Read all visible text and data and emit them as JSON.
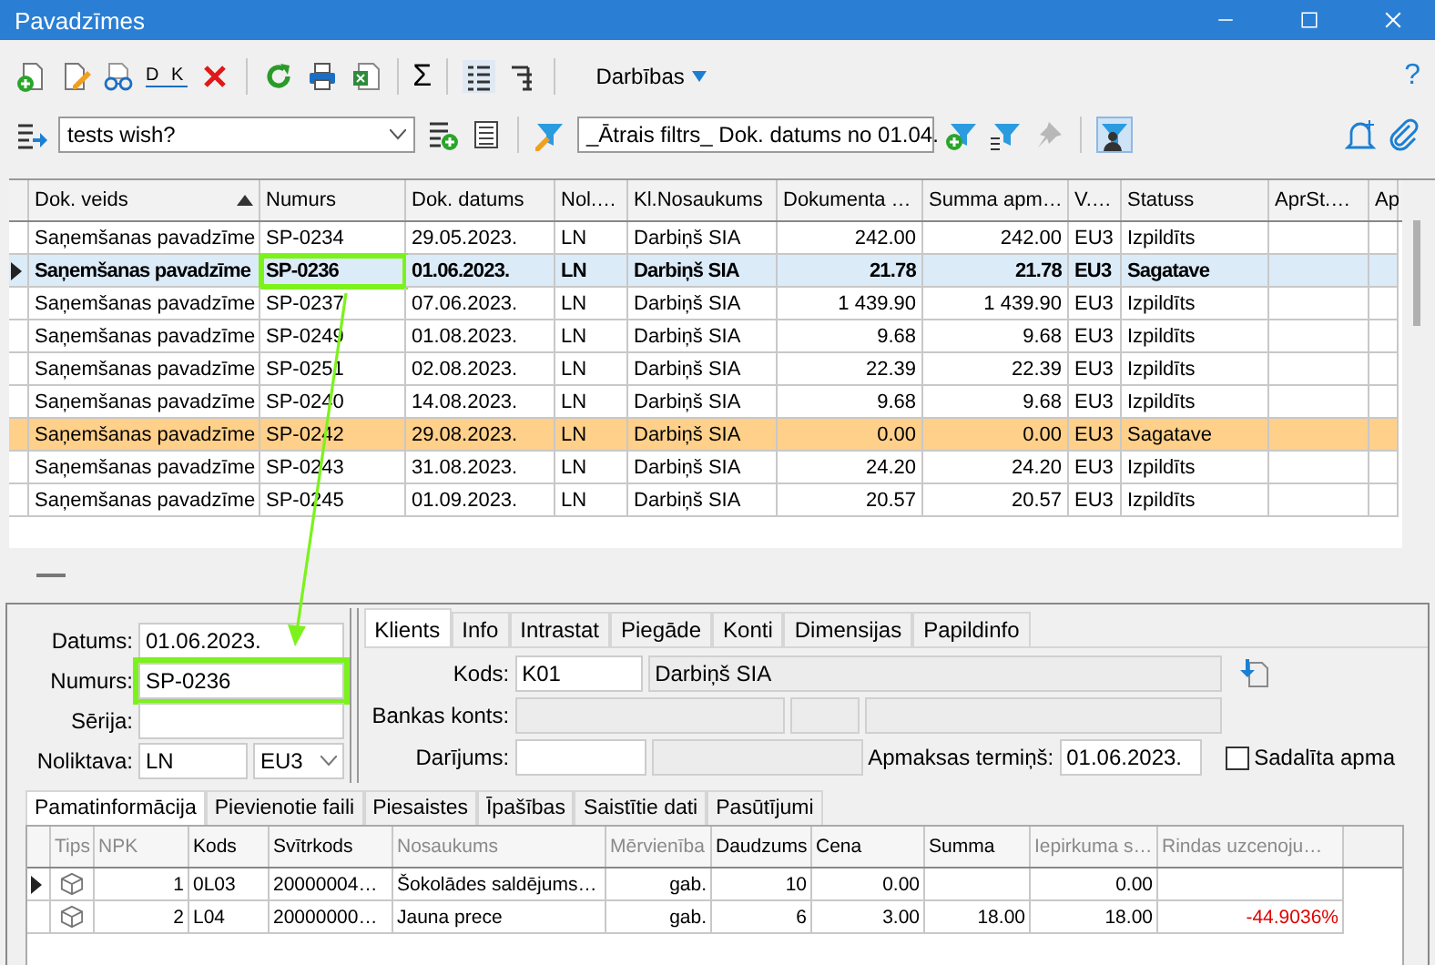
{
  "window": {
    "title": "Pavadzīmes"
  },
  "toolbar": {
    "dk_label": "D K",
    "sum_symbol": "Σ",
    "actions_label": "Darbības",
    "help": "?"
  },
  "filter_bar": {
    "view": "tests wish?",
    "quick_filter": "_Ātrais filtrs_ Dok. datums no 01.04.",
    "user_filter_on": true
  },
  "documents": {
    "columns": [
      {
        "label": "Dok. veids",
        "sorted": true
      },
      {
        "label": "Numurs",
        "sorted": false
      },
      {
        "label": "Dok. datums",
        "sorted": false
      },
      {
        "label": "Nol.…",
        "sorted": false
      },
      {
        "label": "Kl.Nosaukums",
        "sorted": false
      },
      {
        "label": "Dokumenta …",
        "sorted": false
      },
      {
        "label": "Summa apm…",
        "sorted": false
      },
      {
        "label": "V.…",
        "sorted": false
      },
      {
        "label": "Statuss",
        "sorted": false
      },
      {
        "label": "AprSt.…",
        "sorted": false
      },
      {
        "label": "Ap",
        "sorted": false
      }
    ],
    "rows": [
      {
        "selected": false,
        "highlighted": false,
        "annotated": false,
        "cells": [
          "Saņemšanas pavadzīme",
          "SP-0234",
          "29.05.2023.",
          "LN",
          "Darbiņš SIA",
          "242.00",
          "242.00",
          "EU3",
          "Izpildīts"
        ]
      },
      {
        "selected": true,
        "highlighted": false,
        "annotated": true,
        "cells": [
          "Saņemšanas pavadzīme",
          "SP-0236",
          "01.06.2023.",
          "LN",
          "Darbiņš SIA",
          "21.78",
          "21.78",
          "EU3",
          "Sagatave"
        ]
      },
      {
        "selected": false,
        "highlighted": false,
        "annotated": false,
        "cells": [
          "Saņemšanas pavadzīme",
          "SP-0237",
          "07.06.2023.",
          "LN",
          "Darbiņš SIA",
          "1 439.90",
          "1 439.90",
          "EU3",
          "Izpildīts"
        ]
      },
      {
        "selected": false,
        "highlighted": false,
        "annotated": false,
        "cells": [
          "Saņemšanas pavadzīme",
          "SP-0249",
          "01.08.2023.",
          "LN",
          "Darbiņš SIA",
          "9.68",
          "9.68",
          "EU3",
          "Izpildīts"
        ]
      },
      {
        "selected": false,
        "highlighted": false,
        "annotated": false,
        "cells": [
          "Saņemšanas pavadzīme",
          "SP-0251",
          "02.08.2023.",
          "LN",
          "Darbiņš SIA",
          "22.39",
          "22.39",
          "EU3",
          "Izpildīts"
        ]
      },
      {
        "selected": false,
        "highlighted": false,
        "annotated": false,
        "cells": [
          "Saņemšanas pavadzīme",
          "SP-0240",
          "14.08.2023.",
          "LN",
          "Darbiņš SIA",
          "9.68",
          "9.68",
          "EU3",
          "Izpildīts"
        ]
      },
      {
        "selected": false,
        "highlighted": true,
        "annotated": false,
        "cells": [
          "Saņemšanas pavadzīme",
          "SP-0242",
          "29.08.2023.",
          "LN",
          "Darbiņš SIA",
          "0.00",
          "0.00",
          "EU3",
          "Sagatave"
        ]
      },
      {
        "selected": false,
        "highlighted": false,
        "annotated": false,
        "cells": [
          "Saņemšanas pavadzīme",
          "SP-0243",
          "31.08.2023.",
          "LN",
          "Darbiņš SIA",
          "24.20",
          "24.20",
          "EU3",
          "Izpildīts"
        ]
      },
      {
        "selected": false,
        "highlighted": false,
        "annotated": false,
        "cells": [
          "Saņemšanas pavadzīme",
          "SP-0245",
          "01.09.2023.",
          "LN",
          "Darbiņš SIA",
          "20.57",
          "20.57",
          "EU3",
          "Izpildīts"
        ]
      }
    ]
  },
  "header_form": {
    "fields": [
      {
        "label": "Datums:",
        "value": "01.06.2023.",
        "annotated": false
      },
      {
        "label": "Numurs:",
        "value": "SP-0236",
        "annotated": true
      },
      {
        "label": "Sērija:",
        "annotated": false
      },
      {
        "label": "Noliktava:",
        "value": "LN",
        "annotated": false
      }
    ],
    "currency": "EU3"
  },
  "detail_tabs": [
    {
      "label": "Klients",
      "selected": true
    },
    {
      "label": "Info",
      "selected": false
    },
    {
      "label": "Intrastat",
      "selected": false
    },
    {
      "label": "Piegāde",
      "selected": false
    },
    {
      "label": "Konti",
      "selected": false
    },
    {
      "label": "Dimensijas",
      "selected": false
    },
    {
      "label": "Papildinfo",
      "selected": false
    }
  ],
  "client": {
    "code_label": "Kods:",
    "code": "K01",
    "name": "Darbiņš SIA",
    "bank_label": "Bankas konts:",
    "deal_label": "Darījums:",
    "due_label": "Apmaksas termiņš:",
    "due_date": "01.06.2023.",
    "split_label": "Sadalīta apma",
    "split_checked": false
  },
  "lines_tabs": [
    {
      "label": "Pamatinformācija",
      "selected": true
    },
    {
      "label": "Pievienotie faili",
      "selected": false
    },
    {
      "label": "Piesaistes",
      "selected": false
    },
    {
      "label": "Īpašības",
      "selected": false
    },
    {
      "label": "Saistītie dati",
      "selected": false
    },
    {
      "label": "Pasūtījumi",
      "selected": false
    }
  ],
  "lines": {
    "columns": [
      {
        "label": "Tips",
        "editable": false
      },
      {
        "label": "NPK",
        "editable": false
      },
      {
        "label": "Kods",
        "editable": true
      },
      {
        "label": "Svītrkods",
        "editable": true
      },
      {
        "label": "Nosaukums",
        "editable": false
      },
      {
        "label": "Mērvienība",
        "editable": false
      },
      {
        "label": "Daudzums",
        "editable": true
      },
      {
        "label": "Cena",
        "editable": true
      },
      {
        "label": "Summa",
        "editable": true
      },
      {
        "label": "Iepirkuma s…",
        "editable": false
      },
      {
        "label": "Rindas uzcenoju…",
        "editable": false
      }
    ],
    "rows": [
      {
        "selected": true,
        "negative_markup": false,
        "cells": [
          "",
          "1",
          "0L03",
          "20000004…",
          "Šokolādes saldējums…",
          "gab.",
          "10",
          "0.00",
          "",
          "0.00",
          ""
        ]
      },
      {
        "selected": false,
        "negative_markup": true,
        "cells": [
          "",
          "2",
          "L04",
          "20000000…",
          "Jauna prece",
          "gab.",
          "6",
          "3.00",
          "18.00",
          "18.00",
          "-44.9036%"
        ]
      }
    ]
  }
}
